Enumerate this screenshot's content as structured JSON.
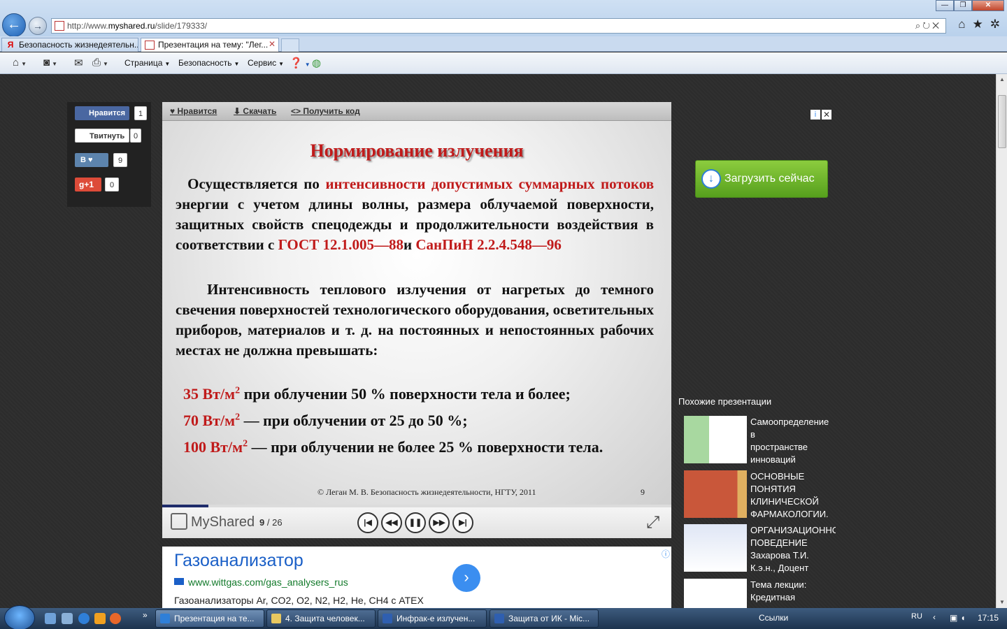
{
  "browser": {
    "url_prefix": "http://www.",
    "url_domain": "myshared.ru",
    "url_path": "/slide/179333/",
    "tabs": [
      {
        "label": "Безопасность жизнедеятельн..."
      },
      {
        "label": "Презентация на тему: \"Лег..."
      }
    ],
    "command_bar": {
      "page": "Страница",
      "safety": "Безопасность",
      "tools": "Сервис"
    }
  },
  "social": {
    "facebook_label": "Нравится",
    "facebook_count": "1",
    "twitter_label": "Твитнуть",
    "twitter_count": "0",
    "vk_label": "В",
    "vk_count": "9",
    "gplus_label": "g+1",
    "gplus_count": "0"
  },
  "slide_toolbar": {
    "like": "Нравится",
    "download": "Скачать",
    "embed": "Получить код"
  },
  "slide": {
    "title": "Нормирование излучения",
    "p1_part1": "Осуществляется по",
    "p1_red1": "интенсивности допустимых суммарных потоков",
    "p1_part2": "энергии с учетом длины волны, размера облучаемой поверхности, защитных свойств спецодежды и продолжительности воздействия в соответствии с",
    "p1_red2": "ГОСТ 12.1.005—88",
    "p1_and": "и",
    "p1_red3": "СанПиН 2.2.4.548—96",
    "p2": "Интенсивность теплового излучения от нагретых до темного свечения поверхностей технологического оборудования, осветительных приборов, материалов и т. д. на постоянных и непостоянных рабочих местах не должна превышать:",
    "bullet1_value": "35 Вт/м",
    "bullet1_text": "при облучении 50 % поверхности тела и более;",
    "bullet2_value": "70 Вт/м",
    "bullet2_text": "— при облучении от 25 до 50 %;",
    "bullet3_value": "100 Вт/м",
    "bullet3_text": "— при облучении не более 25 % поверхности тела.",
    "superscript": "2",
    "footer": "© Леган М. В. Безопасность жизнедеятельности, НГТУ, 2011",
    "number": "9"
  },
  "player": {
    "brand": "MyShared",
    "current": "9",
    "total": "/ 26",
    "progress": 0.09
  },
  "ad_below": {
    "title": "Газоанализатор",
    "url": "www.wittgas.com/gas_analysers_rus",
    "description": "Газоанализаторы Ar, CO2, O2, N2, H2, He, CH4 с ATEX"
  },
  "ad_right": {
    "button_label": "Загрузить сейчас"
  },
  "similar": {
    "heading": "Похожие презентации",
    "items": [
      {
        "title": "Самоопределение\nв\nпространстве\nинноваций"
      },
      {
        "title": "ОСНОВНЫЕ\nПОНЯТИЯ\nКЛИНИЧЕСКОЙ\nФАРМАКОЛОГИИ."
      },
      {
        "title": "ОРГАНИЗАЦИОННОЕ\nПОВЕДЕНИЕ\nЗахарова Т.И.\nК.э.н., Доцент"
      },
      {
        "title": "Тема лекции:\nКредитная"
      }
    ]
  },
  "taskbar": {
    "tasks": [
      {
        "label": "Презентация на те..."
      },
      {
        "label": "4. Защита человек..."
      },
      {
        "label": "Инфрак-е излучен..."
      },
      {
        "label": "Защита от ИК - Mic..."
      }
    ],
    "links": "Ссылки",
    "lang": "RU",
    "time": "17:15"
  },
  "colors": {
    "accent_red": "#c01b1b",
    "progress": "#1f2c6b",
    "ad_link": "#1a5fc7",
    "download_green": "#56a01d"
  }
}
